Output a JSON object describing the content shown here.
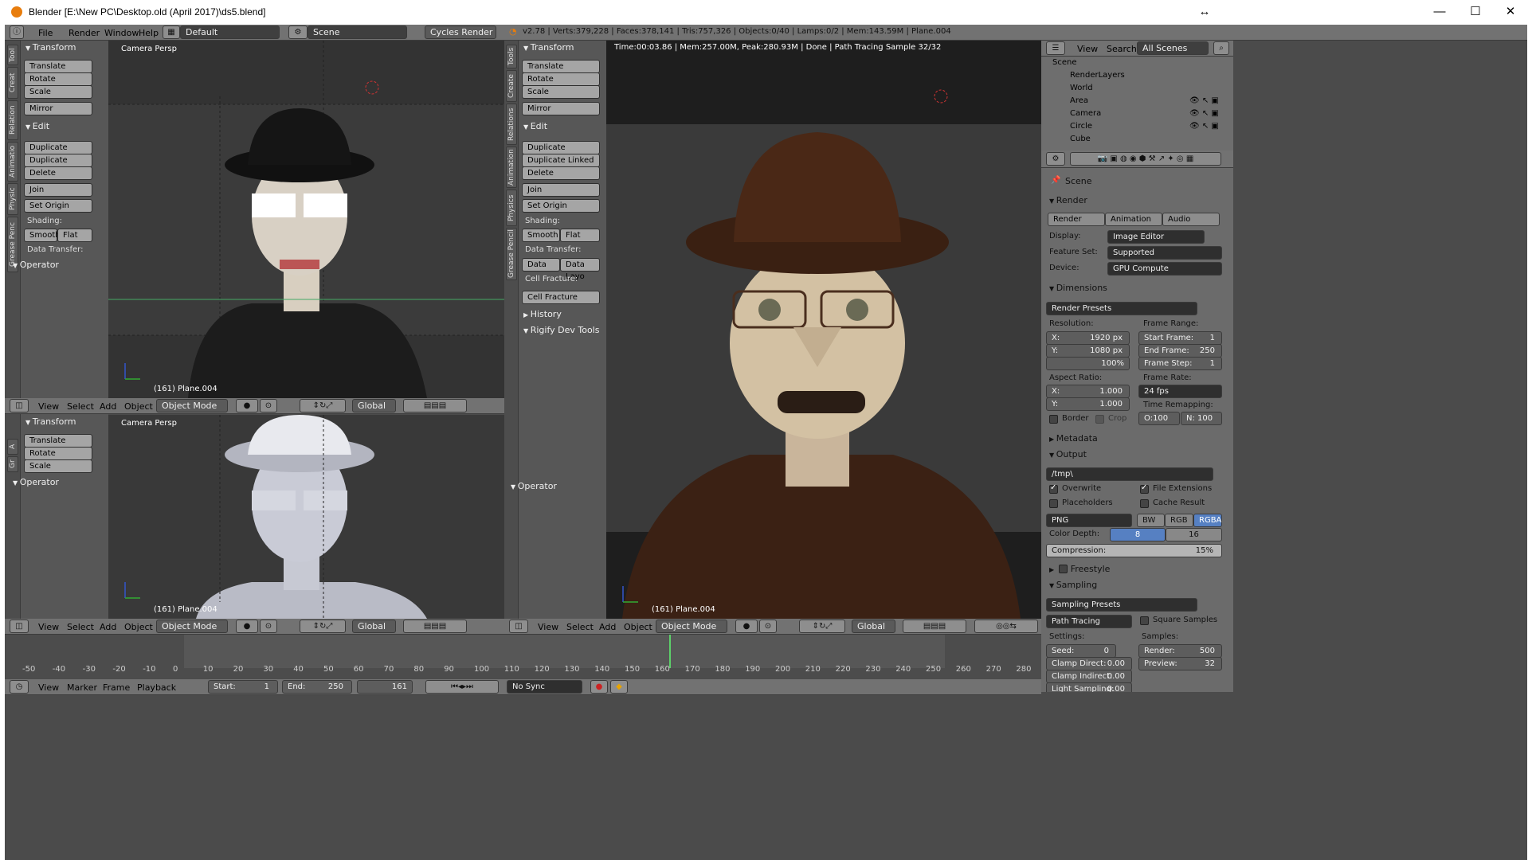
{
  "window": {
    "title": "Blender [E:\\New PC\\Desktop.old (April 2017)\\ds5.blend]",
    "restore": "↔",
    "minimize": "—",
    "maximize": "☐",
    "close": "✕"
  },
  "topbar": {
    "menus": [
      "File",
      "Render",
      "Window",
      "Help"
    ],
    "screen": "Default",
    "scene": "Scene",
    "engine": "Cycles Render",
    "stats": "v2.78 | Verts:379,228 | Faces:378,141 | Tris:757,326 | Objects:0/40 | Lamps:0/2 | Mem:143.59M | Plane.004"
  },
  "toolshelf": {
    "tabs": [
      "Tool",
      "Creat",
      "Relation",
      "Animatio",
      "Physic",
      "Grease Penc"
    ],
    "tabs_bottom": [
      "A",
      "Gr"
    ],
    "tabs_mid": [
      "Tools",
      "Create",
      "Relations",
      "Animation",
      "Physics",
      "Grease Pencil"
    ],
    "transform": "Transform",
    "translate": "Translate",
    "rotate": "Rotate",
    "scale": "Scale",
    "mirror": "Mirror",
    "edit": "Edit",
    "duplicate": "Duplicate",
    "duplicate_linked": "Duplicate Linked",
    "delete": "Delete",
    "join": "Join",
    "set_origin": "Set Origin",
    "shading": "Shading:",
    "smooth": "Smooth",
    "flat": "Flat",
    "data_transfer": "Data Transfer:",
    "data": "Data",
    "data_layo": "Data Layo",
    "cell_fracture_lbl": "Cell Fracture:",
    "cell_fracture": "Cell Fracture",
    "history": "History",
    "rigify": "Rigify Dev Tools",
    "operator": "Operator"
  },
  "viewports": {
    "persp": "Camera Persp",
    "object": "(161) Plane.004",
    "render_info": "Time:00:03.86 | Mem:257.00M, Peak:280.93M | Done | Path Tracing Sample 32/32"
  },
  "vp_header": {
    "view": "View",
    "select": "Select",
    "add": "Add",
    "object": "Object",
    "mode": "Object Mode",
    "orient": "Global"
  },
  "outliner": {
    "view": "View",
    "search": "Search",
    "filter": "All Scenes",
    "items": [
      "Scene",
      "RenderLayers",
      "World",
      "Area",
      "Camera",
      "Circle",
      "Cube"
    ]
  },
  "properties": {
    "scene": "Scene",
    "render": "Render",
    "tab_render": "Render",
    "tab_animation": "Animation",
    "tab_audio": "Audio",
    "display_lbl": "Display:",
    "display": "Image Editor",
    "feature_lbl": "Feature Set:",
    "feature": "Supported",
    "device_lbl": "Device:",
    "device": "GPU Compute",
    "dimensions": "Dimensions",
    "render_presets": "Render Presets",
    "resolution": "Resolution:",
    "res_x_l": "X:",
    "res_x": "1920 px",
    "res_y_l": "Y:",
    "res_y": "1080 px",
    "res_pct": "100%",
    "frame_range": "Frame Range:",
    "start_l": "Start Frame:",
    "start": "1",
    "end_l": "End Frame:",
    "end": "250",
    "step_l": "Frame Step:",
    "step": "1",
    "aspect": "Aspect Ratio:",
    "asp_x_l": "X:",
    "asp_x": "1.000",
    "asp_y_l": "Y:",
    "asp_y": "1.000",
    "frame_rate": "Frame Rate:",
    "fps": "24 fps",
    "border": "Border",
    "crop": "Crop",
    "time_remap": "Time Remapping:",
    "o_val": "O:100",
    "n_val": "N: 100",
    "metadata": "Metadata",
    "output": "Output",
    "path": "/tmp\\",
    "overwrite": "Overwrite",
    "file_ext": "File Extensions",
    "placeholders": "Placeholders",
    "cache": "Cache Result",
    "format": "PNG",
    "bw": "BW",
    "rgb": "RGB",
    "rgba": "RGBA",
    "color_depth": "Color Depth:",
    "cd8": "8",
    "cd16": "16",
    "compression": "Compression:",
    "comp_val": "15%",
    "freestyle": "Freestyle",
    "sampling": "Sampling",
    "sampling_presets": "Sampling Presets",
    "path_tracing": "Path Tracing",
    "square": "Square Samples",
    "settings": "Settings:",
    "samples": "Samples:",
    "seed_l": "Seed:",
    "seed": "0",
    "render_l": "Render:",
    "render_s": "500",
    "clamp_d_l": "Clamp Direct:",
    "clamp_d": "0.00",
    "preview_l": "Preview:",
    "preview_s": "32",
    "clamp_i_l": "Clamp Indirect:",
    "clamp_i": "0.00",
    "light_l": "Light Sampling:",
    "light": "0.00"
  },
  "timeline": {
    "ticks": [
      "-50",
      "-40",
      "-30",
      "-20",
      "-10",
      "0",
      "10",
      "20",
      "30",
      "40",
      "50",
      "60",
      "70",
      "80",
      "90",
      "100",
      "110",
      "120",
      "130",
      "140",
      "150",
      "160",
      "170",
      "180",
      "190",
      "200",
      "210",
      "220",
      "230",
      "240",
      "250",
      "260",
      "270",
      "280"
    ],
    "view": "View",
    "marker": "Marker",
    "frame": "Frame",
    "playback": "Playback",
    "start_l": "Start:",
    "start": "1",
    "end_l": "End:",
    "end": "250",
    "current": "161",
    "sync": "No Sync"
  }
}
